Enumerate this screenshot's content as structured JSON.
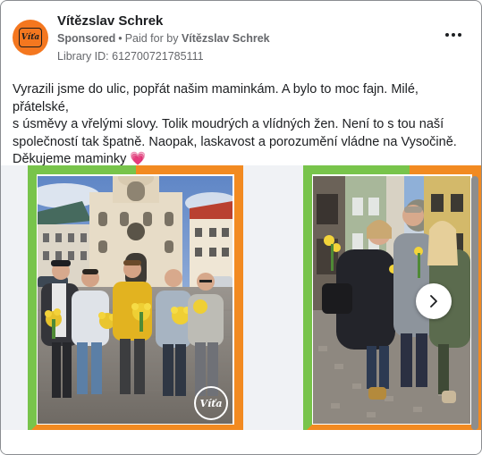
{
  "post": {
    "author": "Vítězslav Schrek",
    "sponsored_label": "Sponsored",
    "separator": "•",
    "paid_for_prefix": "Paid for by",
    "paid_for_name": "Vítězslav Schrek",
    "library_id": "Library ID: 612700721785111",
    "body_line1": "Vyrazili jsme do ulic, popřát našim maminkám. A bylo to moc fajn. Milé, přátelské,",
    "body_line2": "s úsměvy a vřelými slovy. Tolik moudrých a vlídných žen. Není to s tou naší",
    "body_line3": "společností tak špatně. Naopak, laskavost a porozumění vládne na Vysočině.",
    "body_line4": "Děkujeme maminky",
    "heart_emoji": "💗"
  },
  "avatar": {
    "logo_text": "Víťa"
  },
  "carousel": {
    "watermark_text": "Víťa",
    "next_icon": "chevron-right-icon"
  },
  "colors": {
    "frame_green": "#78c44b",
    "frame_orange": "#f28a21",
    "avatar_orange": "#f4771f",
    "meta_gray": "#65676b"
  }
}
